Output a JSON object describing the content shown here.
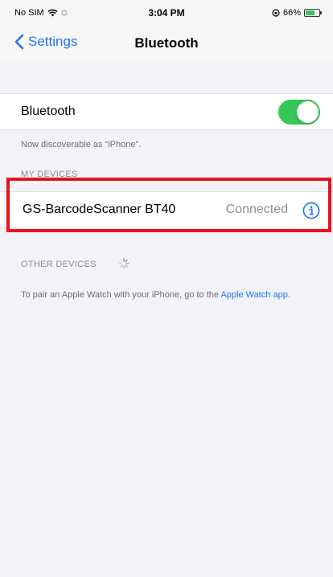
{
  "status_bar": {
    "carrier": "No SIM",
    "time": "3:04 PM",
    "battery_percent": "66%",
    "battery_level": 0.66
  },
  "nav": {
    "back_label": "Settings",
    "title": "Bluetooth"
  },
  "bluetooth_row": {
    "label": "Bluetooth",
    "enabled": true
  },
  "discoverable_note": "Now discoverable as “iPhone”.",
  "my_devices": {
    "header": "MY DEVICES",
    "items": [
      {
        "name": "GS-BarcodeScanner BT40",
        "status": "Connected"
      }
    ]
  },
  "other_devices": {
    "header": "OTHER DEVICES"
  },
  "pair_note": {
    "text": "To pair an Apple Watch with your iPhone, go to the ",
    "link": "Apple Watch app",
    "suffix": "."
  },
  "colors": {
    "accent": "#1d74f5",
    "toggle_on": "#34c759",
    "highlight": "#e6131b"
  }
}
